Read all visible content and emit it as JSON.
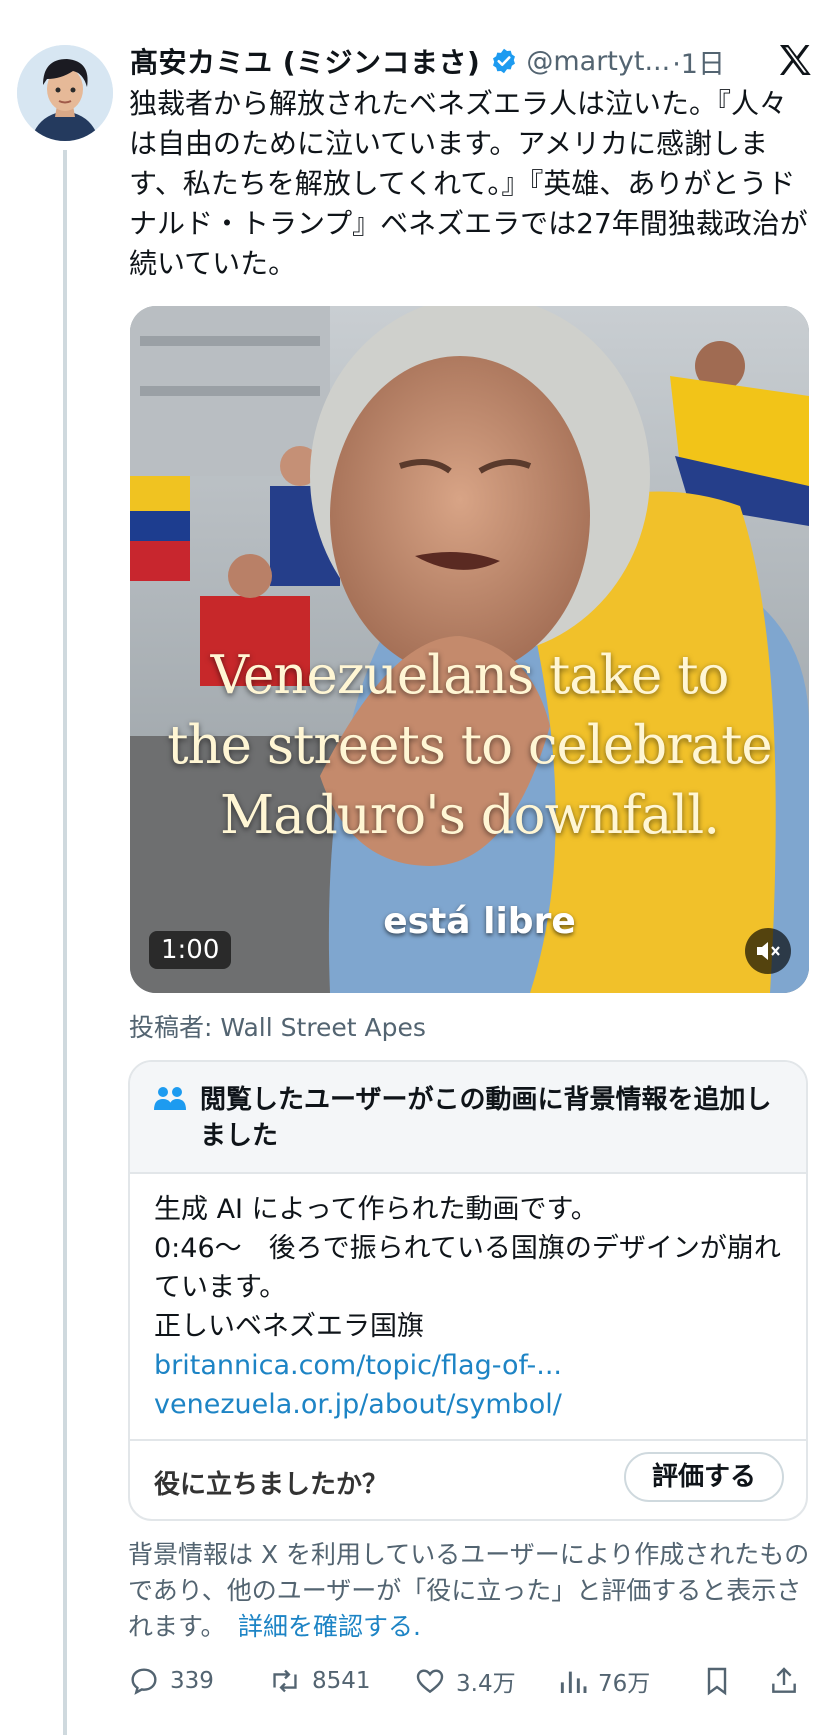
{
  "author": {
    "name": "髙安カミユ (ミジンコまさ)",
    "handle": "@martyt...",
    "time": "·1日"
  },
  "tweet_text": "独裁者から解放されたベネズエラ人は泣いた。『人々は自由のために泣いています。アメリカに感謝します、私たちを解放してくれて。』『英雄、ありがとうドナルド・トランプ』ベネズエラでは27年間独裁政治が続いていた。",
  "video": {
    "caption_lines": [
      "Venezuelans take to",
      "the streets to celebrate",
      "Maduro's downfall."
    ],
    "subtitle": "está libre",
    "duration": "1:00"
  },
  "posted_by": "投稿者: Wall Street Apes",
  "community_note": {
    "title": "閲覧したユーザーがこの動画に背景情報を追加しました",
    "body_lines": [
      "生成 AI によって作られた動画です。",
      "0:46～　後ろで振られている国旗のデザインが崩れています。",
      "正しいベネズエラ国旗"
    ],
    "links": [
      "britannica.com/topic/flag-of-...",
      "venezuela.or.jp/about/symbol/"
    ],
    "helpful_question": "役に立ちましたか？",
    "rate_button": "評価する"
  },
  "disclaimer": {
    "text": "背景情報は X を利用しているユーザーにより作成されたものであり、他のユーザーが「役に立った」と評価すると表示されます。",
    "more_link": "詳細を確認する",
    "end": "."
  },
  "actions": {
    "replies": "339",
    "reposts": "8541",
    "likes": "3.4万",
    "views": "76万"
  },
  "colors": {
    "verified": "#1d9bf0",
    "link": "#1d84c5",
    "secondary_text": "#536471"
  }
}
